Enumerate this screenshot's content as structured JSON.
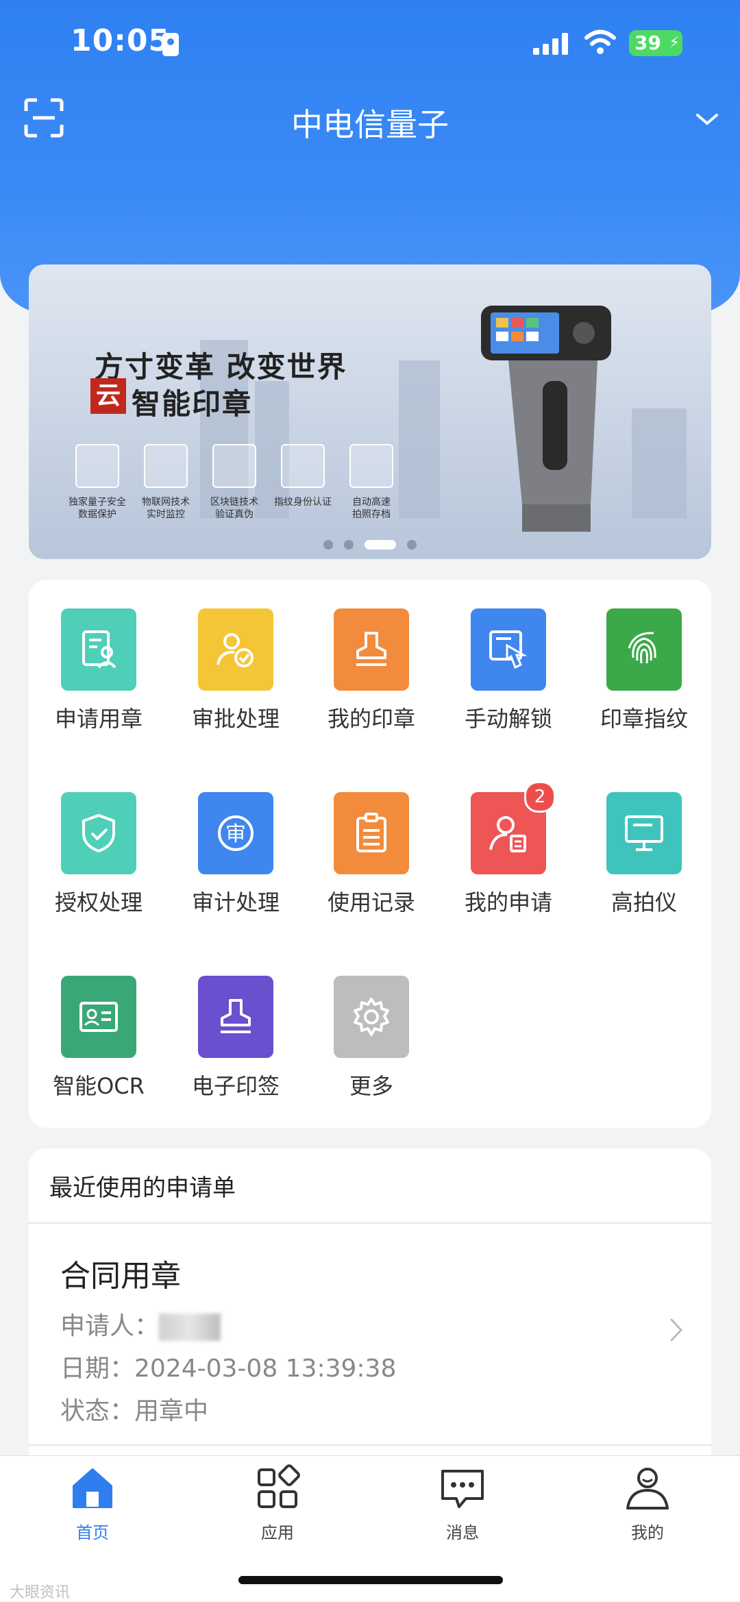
{
  "status_bar": {
    "time": "10:05",
    "battery": "39"
  },
  "header": {
    "title": "中电信量子"
  },
  "banner": {
    "headline": "方寸变革 改变世界",
    "product_badge": "云",
    "product_name": "智能印章",
    "features": [
      {
        "line1": "独家量子安全",
        "line2": "数据保护"
      },
      {
        "line1": "物联网技术",
        "line2": "实时监控"
      },
      {
        "line1": "区块链技术",
        "line2": "验证真伪"
      },
      {
        "line1": "指纹身份认证",
        "line2": ""
      },
      {
        "line1": "自动高速",
        "line2": "拍照存档"
      }
    ],
    "active_slide": 3,
    "slide_count": 4
  },
  "apps": [
    {
      "label": "申请用章",
      "icon": "form-person-icon",
      "color": "#4fcfb7"
    },
    {
      "label": "审批处理",
      "icon": "user-check-icon",
      "color": "#f4c536"
    },
    {
      "label": "我的印章",
      "icon": "stamp-icon",
      "color": "#f28b3c"
    },
    {
      "label": "手动解锁",
      "icon": "touch-unlock-icon",
      "color": "#3f86ef"
    },
    {
      "label": "印章指纹",
      "icon": "fingerprint-icon",
      "color": "#3ba84a"
    },
    {
      "label": "授权处理",
      "icon": "shield-check-icon",
      "color": "#4fcfb7"
    },
    {
      "label": "审计处理",
      "icon": "audit-icon",
      "color": "#3f86ef"
    },
    {
      "label": "使用记录",
      "icon": "clipboard-icon",
      "color": "#f28b3c"
    },
    {
      "label": "我的申请",
      "icon": "user-doc-icon",
      "color": "#ee5555",
      "badge": "2"
    },
    {
      "label": "高拍仪",
      "icon": "monitor-icon",
      "color": "#3ec4bc"
    },
    {
      "label": "智能OCR",
      "icon": "id-card-icon",
      "color": "#3aa876"
    },
    {
      "label": "电子印签",
      "icon": "e-stamp-icon",
      "color": "#6a4fcf"
    },
    {
      "label": "更多",
      "icon": "gear-icon",
      "color": "#bdbdbd"
    }
  ],
  "recent": {
    "title": "最近使用的申请单",
    "item": {
      "type": "合同用章",
      "applicant_label": "申请人：",
      "date_label": "日期：",
      "date": "2024-03-08 13:39:38",
      "status_label": "状态：",
      "status": "用章中"
    }
  },
  "nav": [
    {
      "label": "首页",
      "active": true
    },
    {
      "label": "应用"
    },
    {
      "label": "消息"
    },
    {
      "label": "我的"
    }
  ],
  "watermark": "大眼资讯",
  "colors": {
    "primary": "#2f7ef0",
    "badge": "#ee4d4d"
  }
}
